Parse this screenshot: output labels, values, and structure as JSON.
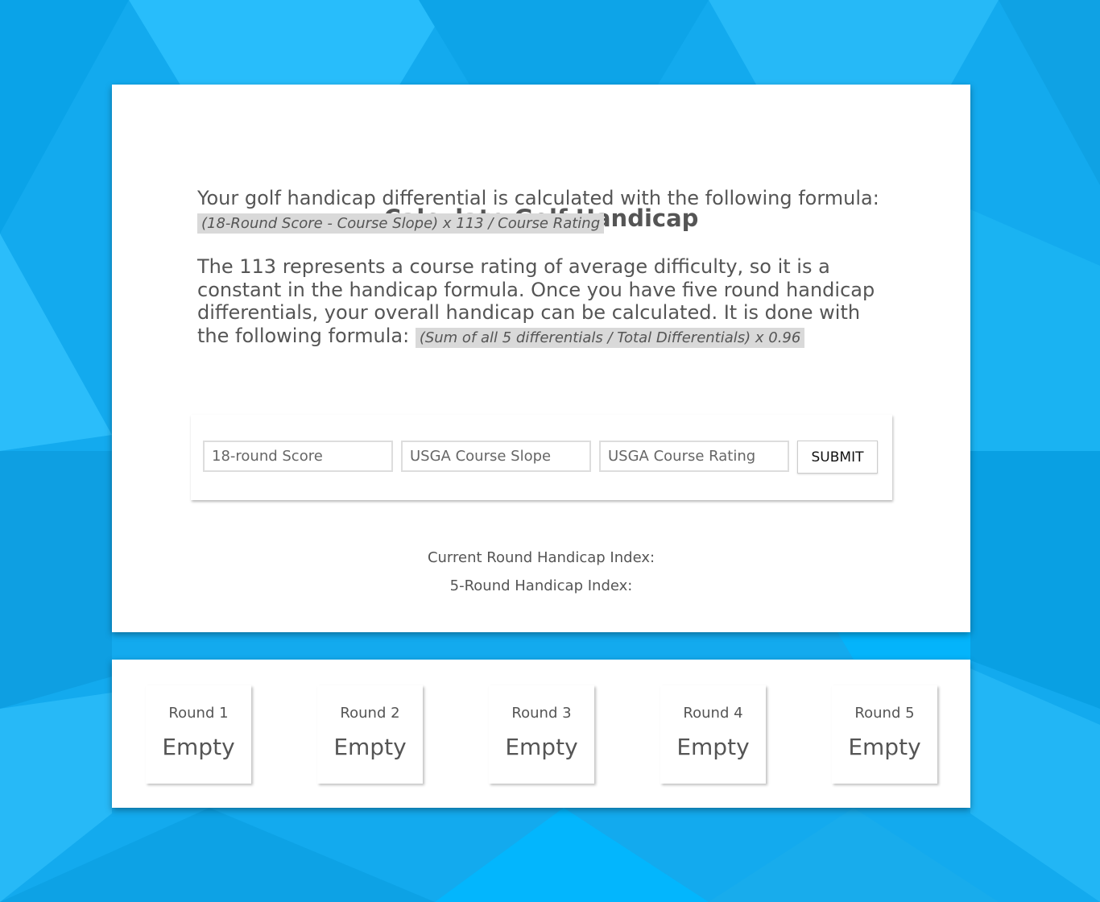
{
  "page": {
    "title": "Calculate Golf Handicap",
    "intro_text": "Your golf handicap differential is calculated with the following formula:",
    "intro_formula": "(18-Round Score - Course Slope) x 113 / Course Rating",
    "detail_text": "The 113 represents a course rating of average difficulty, so it is a constant in the handicap formula. Once you have five round handicap differentials, your overall handicap can be calculated. It is done with the following formula:",
    "detail_formula": "(Sum of all 5 differentials / Total Differentials) x 0.96"
  },
  "form": {
    "score_placeholder": "18-round Score",
    "slope_placeholder": "USGA Course Slope",
    "rating_placeholder": "USGA Course Rating",
    "submit_label": "SUBMIT"
  },
  "results": {
    "current_label": "Current Round Handicap Index:",
    "five_round_label": "5-Round Handicap Index:"
  },
  "rounds": [
    {
      "label": "Round 1",
      "value": "Empty"
    },
    {
      "label": "Round 2",
      "value": "Empty"
    },
    {
      "label": "Round 3",
      "value": "Empty"
    },
    {
      "label": "Round 4",
      "value": "Empty"
    },
    {
      "label": "Round 5",
      "value": "Empty"
    }
  ],
  "colors": {
    "background": "#13aaee",
    "card": "#ffffff",
    "text": "#555555",
    "formula_highlight": "#d9d9d9"
  }
}
